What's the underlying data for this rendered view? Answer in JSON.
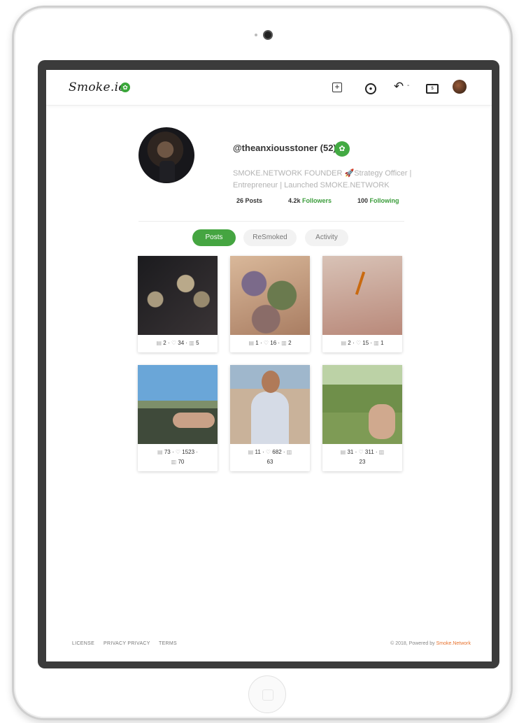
{
  "header": {
    "brand": "Smoke.io",
    "brand_icon": "leaf-icon",
    "icons": [
      "create-post-icon",
      "explore-icon",
      "reply-icon",
      "wallet-icon",
      "user-avatar"
    ],
    "reply_caret": "-"
  },
  "profile": {
    "username": "@theanxiousstoner (52)",
    "bio": "SMOKE.NETWORK FOUNDER 🚀Strategy Officer | Entrepreneur | Launched SMOKE.NETWORK",
    "stats": {
      "posts_value": "26",
      "posts_label": "Posts",
      "followers_value": "4.2k",
      "followers_label": "Followers",
      "following_value": "100",
      "following_label": "Following"
    },
    "accent_color": "#45a541"
  },
  "tabs": [
    {
      "label": "Posts",
      "active": true
    },
    {
      "label": "ReSmoked",
      "active": false
    },
    {
      "label": "Activity",
      "active": false
    }
  ],
  "posts": [
    {
      "comments": "2",
      "likes": "34",
      "resmokes": "5"
    },
    {
      "comments": "1",
      "likes": "16",
      "resmokes": "2"
    },
    {
      "comments": "2",
      "likes": "15",
      "resmokes": "1"
    },
    {
      "comments": "73",
      "likes": "1523",
      "resmokes": "70"
    },
    {
      "comments": "11",
      "likes": "682",
      "resmokes": "63"
    },
    {
      "comments": "31",
      "likes": "311",
      "resmokes": "23"
    }
  ],
  "footer": {
    "links": [
      "LICENSE",
      "PRIVACY PRIVACY",
      "TERMS"
    ],
    "copyright": "© 2018, Powered by",
    "powered_by": "Smoke.Network"
  }
}
